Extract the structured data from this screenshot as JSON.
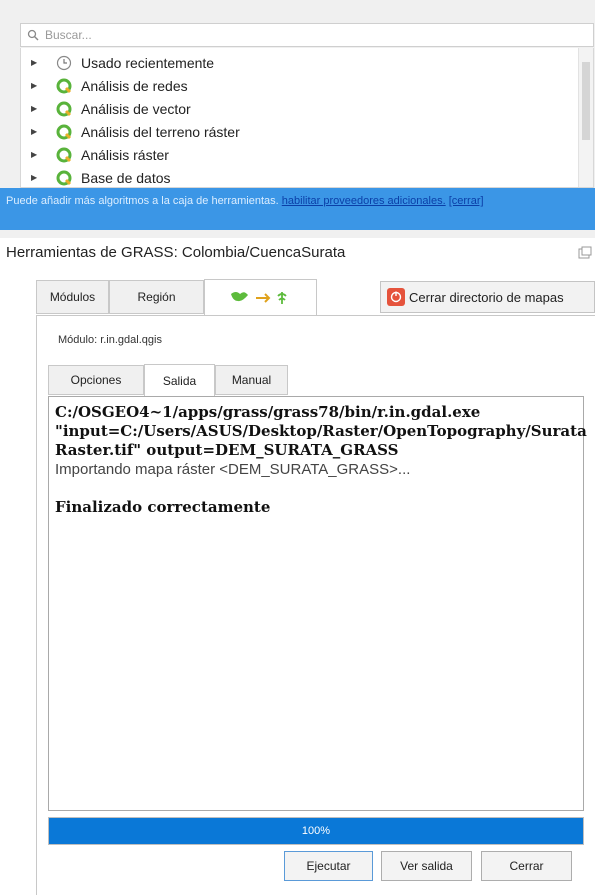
{
  "toolbox": {
    "search_placeholder": "Buscar...",
    "tree_items": [
      {
        "label": "Usado recientemente",
        "icon": "clock-icon"
      },
      {
        "label": "Análisis de redes",
        "icon": "qgis-icon"
      },
      {
        "label": "Análisis de vector",
        "icon": "qgis-icon"
      },
      {
        "label": "Análisis del terreno ráster",
        "icon": "qgis-icon"
      },
      {
        "label": "Análisis ráster",
        "icon": "qgis-icon"
      },
      {
        "label": "Base de datos",
        "icon": "qgis-icon"
      }
    ],
    "info_text": "Puede añadir más algoritmos a la caja de herramientas.",
    "info_link": "habilitar proveedores adicionales.",
    "info_close": "[cerrar]"
  },
  "grass": {
    "title": "Herramientas de GRASS: Colombia/CuencaSurata",
    "tabs": [
      "Módulos",
      "Región"
    ],
    "close_mapset_label": "Cerrar directorio de mapas",
    "module_label": "Módulo: r.in.gdal.qgis",
    "subtabs": [
      "Opciones",
      "Salida",
      "Manual"
    ],
    "output": {
      "command": "C:/OSGEO4~1/apps/grass/grass78/bin/r.in.gdal.exe \"input=C:/Users/ASUS/Desktop/Raster/OpenTopography/Surata Raster.tif\" output=DEM_SURATA_GRASS",
      "message": "Importando mapa ráster <DEM_SURATA_GRASS>...",
      "status": "Finalizado correctamente"
    },
    "progress_value": 100,
    "progress_text": "100%",
    "buttons": {
      "run": "Ejecutar",
      "view_output": "Ver salida",
      "close": "Cerrar"
    }
  },
  "colors": {
    "info_bar": "#3b96e6",
    "progress_fill": "#0a78d7",
    "qgis_green": "#59b33b",
    "close_red": "#e5533c"
  }
}
